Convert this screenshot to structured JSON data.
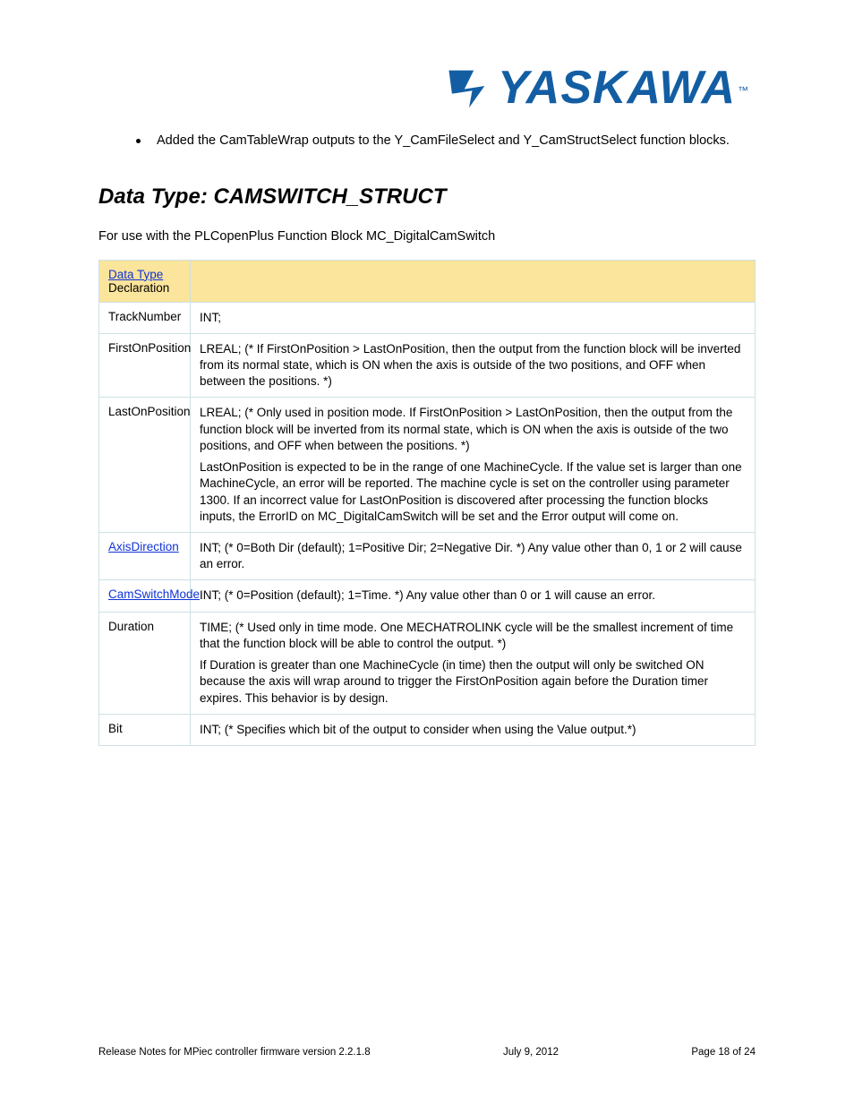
{
  "logo": {
    "brand": "YASKAWA",
    "tm": "™"
  },
  "bullet": "Added the CamTableWrap outputs to the Y_CamFileSelect and Y_CamStructSelect function blocks.",
  "section_heading": "Data Type: CAMSWITCH_STRUCT",
  "intro_line": "For use with the PLCopenPlus Function Block MC_DigitalCamSwitch",
  "table": {
    "header": {
      "col1_link": "Data Type",
      "col1_suffix": " Declaration",
      "col2": ""
    },
    "rows": [
      {
        "c1": [
          {
            "t": "TrackNumber"
          }
        ],
        "c2": [
          {
            "t": "INT;"
          }
        ]
      },
      {
        "c1": [
          {
            "t": "FirstOnPosition"
          }
        ],
        "c2": [
          {
            "t": "LREAL; (* If FirstOnPosition > LastOnPosition, then the output from the function block will be inverted from its normal state, which is ON when the axis is outside of the two positions, and OFF when between the positions. *)"
          }
        ]
      },
      {
        "c1": [
          {
            "t": "LastOnPosition"
          }
        ],
        "c2": [
          {
            "t": "LREAL; (* Only used in position mode. If FirstOnPosition > LastOnPosition, then the output from the function block will be inverted from its normal state, which is ON when the axis is outside of the two positions, and OFF when between the positions. *)"
          },
          {
            "t": "LastOnPosition is expected to be in the range of one MachineCycle. If the value set is larger than one MachineCycle, an error will be reported. The machine cycle is set on the controller using parameter 1300. If an incorrect value for LastOnPosition is discovered after processing the function blocks inputs, the ErrorID on MC_DigitalCamSwitch will be set and the Error output will come on."
          }
        ]
      },
      {
        "c1": [
          {
            "link": "AxisDirection",
            "t": " "
          }
        ],
        "c2": [
          {
            "t": "INT; (* 0=Both Dir (default); 1=Positive Dir; 2=Negative Dir. *) Any value other than 0, 1 or 2 will cause an error."
          }
        ]
      },
      {
        "c1": [
          {
            "link": "CamSwitchMode"
          }
        ],
        "c2": [
          {
            "t": "INT; (* 0=Position (default); 1=Time. *) Any value other than 0 or 1 will cause an error."
          }
        ]
      },
      {
        "c1": [
          {
            "t": "Duration"
          }
        ],
        "c2": [
          {
            "t": "TIME; (* Used only in time mode. One MECHATROLINK cycle will be the smallest increment of time that the function block will be able to control the output. *)"
          },
          {
            "t": "If Duration is greater than one MachineCycle (in time) then the output will only be switched ON because the axis will wrap around to trigger the FirstOnPosition again before the Duration timer expires. This behavior is by design."
          }
        ]
      },
      {
        "c1": [
          {
            "t": "Bit"
          }
        ],
        "c2": [
          {
            "t": "INT; (* Specifies which bit of the output to consider when using the Value output.*)"
          }
        ]
      }
    ]
  },
  "footer": {
    "left": "Release Notes for MPiec controller firmware version 2.2.1.8",
    "center": "July 9, 2012",
    "right": "Page 18 of 24"
  }
}
